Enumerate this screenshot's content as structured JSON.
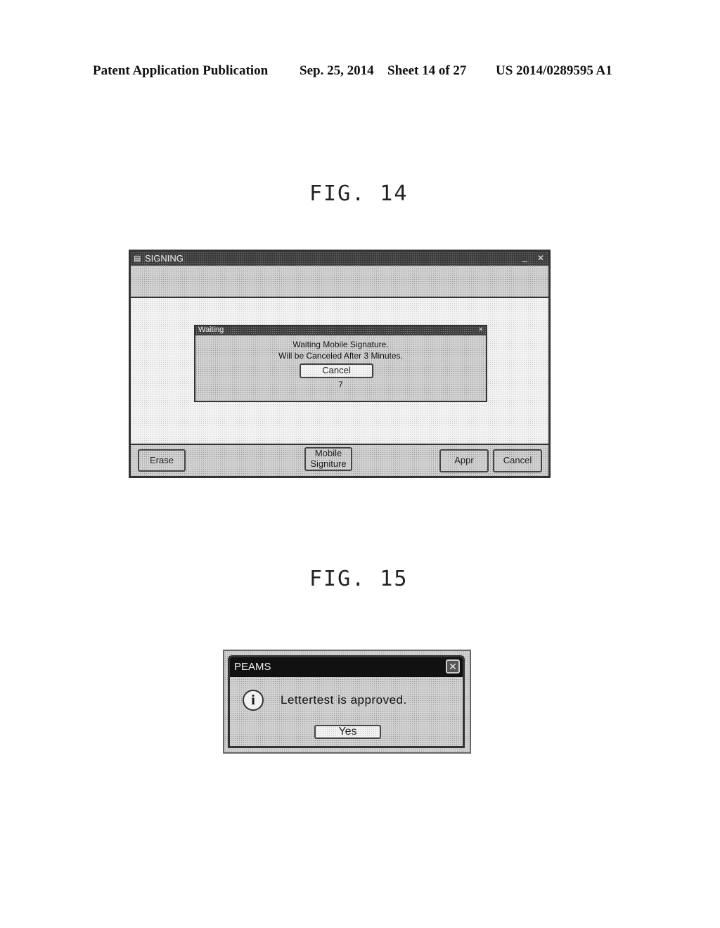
{
  "header": {
    "left": "Patent Application Publication",
    "date": "Sep. 25, 2014",
    "sheet": "Sheet 14 of 27",
    "number": "US 2014/0289595 A1"
  },
  "fig14": {
    "caption": "FIG. 14",
    "window": {
      "title": "SIGNING",
      "minimize_glyph": "_",
      "close_glyph": "✕",
      "buttons": {
        "erase": "Erase",
        "mobile_line1": "Mobile",
        "mobile_line2": "Signiture",
        "appr": "Appr",
        "cancel": "Cancel"
      }
    },
    "dialog": {
      "title": "Waiting",
      "close_glyph": "×",
      "line1": "Waiting Mobile Signature.",
      "line2": "Will be Canceled After 3 Minutes.",
      "cancel_label": "Cancel",
      "countdown": "7"
    }
  },
  "fig15": {
    "caption": "FIG. 15",
    "dialog": {
      "title": "PEAMS",
      "close_glyph": "✕",
      "icon_glyph": "i",
      "message": "Lettertest is approved.",
      "yes_label": "Yes"
    }
  }
}
